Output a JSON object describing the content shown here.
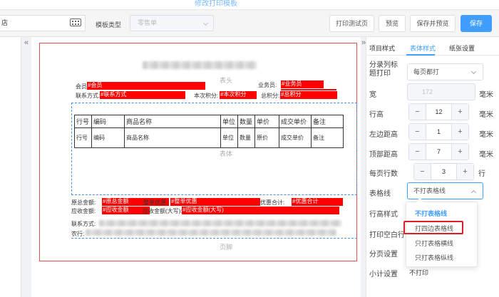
{
  "top": {
    "title": "修改打印模板"
  },
  "toolbar": {
    "store_value": "店",
    "template_type_label": "模板类型",
    "template_type_value": "零售单",
    "buttons": {
      "print_test": "打印测试页",
      "preview": "预览",
      "save_preview": "保存并预览",
      "save": "保存"
    }
  },
  "canvas": {
    "header_label": "表头",
    "body_label": "表体",
    "footer_label": "页脚",
    "header_fields": {
      "member_label": "会员:",
      "member_value": "#会员",
      "salesman_label": "业务员:",
      "salesman_value": "#业务员",
      "contact_label": "联系方式:",
      "contact_value": "#联系方式",
      "points_label": "本次积分:",
      "points_value": "#本次积分",
      "total_points_label": "总积分:",
      "total_points_value": "#总积分"
    },
    "table": {
      "headers": [
        "行号",
        "编码",
        "商品名称",
        "单位",
        "数量",
        "单价",
        "成交单价",
        "备注"
      ],
      "row": [
        "行号",
        "编码",
        "商品名称",
        "单位",
        "数量",
        "原价",
        "成交单价",
        "备注"
      ]
    },
    "footer_fields": {
      "orig_total_label": "原总金额:",
      "orig_total_value": "#原总金额",
      "discount_label": "整单优惠:",
      "discount_value": "#整单优惠",
      "promo_total_label": "优惠合计:",
      "promo_total_value": "#优惠合计",
      "receivable_label": "应收金额:",
      "receivable_value": "#应收金额",
      "receivable_upper_label": "应收金额(大写):",
      "receivable_upper_value": "#应收金额(大写)",
      "contact_label": "联系方式:",
      "bank_label": "农行:"
    }
  },
  "panel": {
    "tabs": [
      "项目样式",
      "表体样式",
      "纸张设置"
    ],
    "active_tab": "表体样式",
    "rows": {
      "title_print_label": "分录列标题打印",
      "title_print_value": "每页都打",
      "width_label": "宽",
      "width_value": "172",
      "row_height_label": "行高",
      "row_height_value": "12",
      "left_margin_label": "左边距高",
      "left_margin_value": "1",
      "top_margin_label": "顶部距高",
      "top_margin_value": "7",
      "rows_per_page_label": "每页行数",
      "rows_per_page_value": "3",
      "rows_per_page_unit": "行",
      "gridline_label": "表格线",
      "gridline_value": "不打表格线",
      "row_style_label": "行高样式",
      "print_blank_label": "打印空白行",
      "page_setting_label": "分页设置",
      "subtotal_label": "小计设置",
      "subtotal_value": "不打印",
      "unit_mm": "毫米"
    },
    "gridline_options": [
      "不打表格线",
      "打四边表格线",
      "只打表格横线",
      "只打表格纵线"
    ]
  },
  "colors": {
    "accent": "#409eff",
    "field_red": "#ff0000",
    "annotation": "#e02020"
  }
}
